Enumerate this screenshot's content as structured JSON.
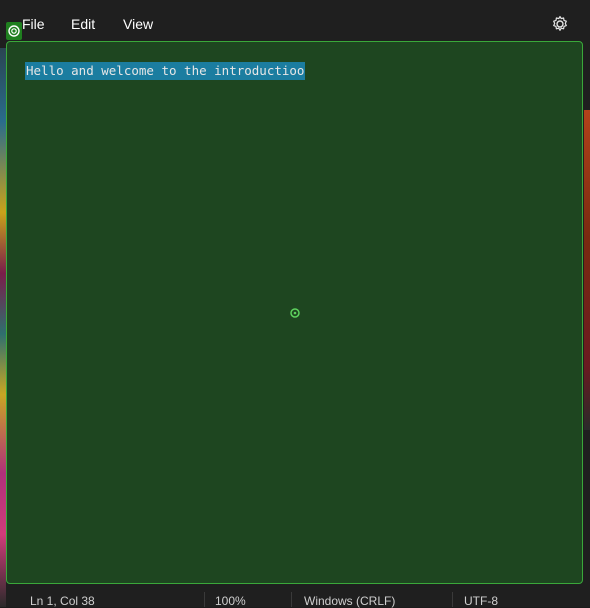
{
  "menubar": {
    "file_label": "File",
    "edit_label": "Edit",
    "view_label": "View"
  },
  "editor": {
    "content": "Hello and welcome to the introductioo"
  },
  "status": {
    "position": "Ln 1, Col 38",
    "zoom": "100%",
    "line_endings": "Windows (CRLF)",
    "encoding": "UTF-8"
  },
  "colors": {
    "editor_background": "#1e4620",
    "editor_border": "#3aa83a",
    "selection": "#1b7da0"
  },
  "icons": {
    "settings": "gear-icon",
    "corner": "target-icon",
    "cursor": "circle-dot-icon"
  }
}
